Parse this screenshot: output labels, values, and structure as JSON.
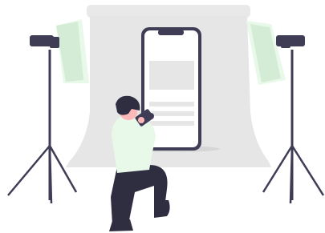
{
  "scene": {
    "subject": "photographer-photographing-smartphone-in-studio",
    "icons": [
      "photo-backdrop",
      "smartphone",
      "studio-light-left",
      "studio-light-right",
      "photographer",
      "camera"
    ]
  },
  "colors": {
    "backdrop_roll": "#e9e9e9",
    "backdrop_sheet": "#e6e6e6",
    "floor_shadow": "#d6d6d6",
    "phone_frame": "#3f3d56",
    "phone_screen": "#ffffff",
    "placeholder": "#e6e6e6",
    "softbox_accent": "#e8f9ea",
    "softbox_inner": "#d4ecd6",
    "stand": "#3f3d56",
    "shirt": "#e8f9ea",
    "pants": "#2f2e41",
    "skin": "#ffb8b8",
    "hair": "#2f2e41"
  }
}
